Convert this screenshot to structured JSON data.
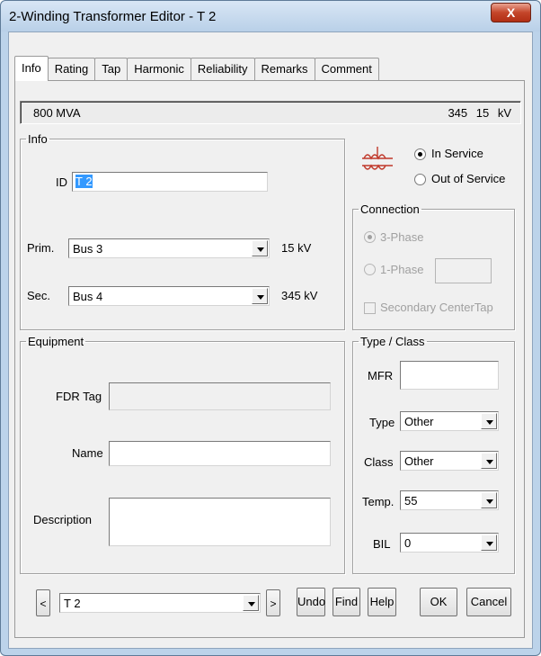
{
  "window": {
    "title": "2-Winding Transformer Editor - T 2",
    "close_label": "X"
  },
  "tabs": [
    {
      "label": "Info",
      "active": true
    },
    {
      "label": "Rating",
      "active": false
    },
    {
      "label": "Tap",
      "active": false
    },
    {
      "label": "Harmonic",
      "active": false
    },
    {
      "label": "Reliability",
      "active": false
    },
    {
      "label": "Remarks",
      "active": false
    },
    {
      "label": "Comment",
      "active": false
    }
  ],
  "info_strip": {
    "rating": "800 MVA",
    "voltages": "345 15 kV"
  },
  "info_group": {
    "legend": "Info",
    "id_label": "ID",
    "id_value": "T 2",
    "prim_label": "Prim.",
    "prim_value": "Bus 3",
    "prim_kv": "15 kV",
    "sec_label": "Sec.",
    "sec_value": "Bus 4",
    "sec_kv": "345 kV"
  },
  "service": {
    "in_service_label": "In Service",
    "out_of_service_label": "Out of Service",
    "selected": "In Service"
  },
  "connection": {
    "legend": "Connection",
    "three_phase_label": "3-Phase",
    "one_phase_label": "1-Phase",
    "one_phase_value": "",
    "secondary_center_tap_label": "Secondary CenterTap",
    "selected": "3-Phase"
  },
  "equipment": {
    "legend": "Equipment",
    "fdr_tag_label": "FDR Tag",
    "fdr_tag_value": "",
    "name_label": "Name",
    "name_value": "",
    "description_label": "Description",
    "description_value": ""
  },
  "type_class": {
    "legend": "Type / Class",
    "mfr_label": "MFR",
    "mfr_value": "",
    "type_label": "Type",
    "type_value": "Other",
    "class_label": "Class",
    "class_value": "Other",
    "temp_label": "Temp.",
    "temp_value": "55",
    "bil_label": "BIL",
    "bil_value": "0"
  },
  "footer": {
    "prev_label": "<",
    "next_label": ">",
    "element_select_value": "T 2",
    "undo_label": "Undo",
    "find_label": "Find",
    "help_label": "Help",
    "ok_label": "OK",
    "cancel_label": "Cancel"
  },
  "icons": {
    "transformer": "transformer-icon",
    "dropdown": "chevron-down-icon"
  },
  "colors": {
    "transformer_icon": "#c0392b",
    "selection": "#3399ff",
    "close_button": "#c4452a"
  }
}
